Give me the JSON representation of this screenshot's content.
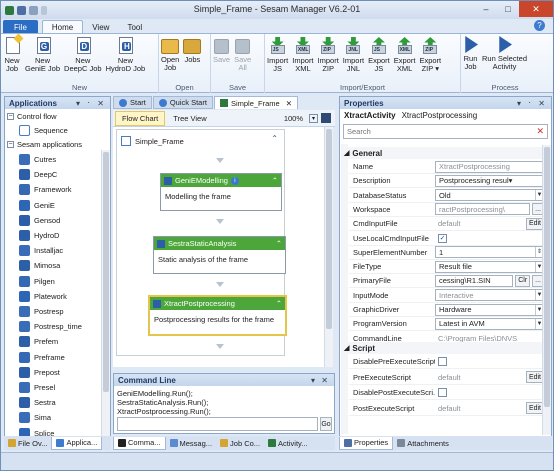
{
  "app": {
    "title": "Simple_Frame - Sesam Manager V6.2-01"
  },
  "window": {
    "min": "–",
    "max": "□",
    "close": "✕"
  },
  "tabs": {
    "file": "File",
    "home": "Home",
    "view": "View",
    "tool": "Tool"
  },
  "ribbon": {
    "groups": {
      "new": "New",
      "open": "Open",
      "save": "Save",
      "import_export": "Import/Export",
      "process": "Process"
    },
    "new": [
      {
        "label": "New\nJob",
        "icon": "new-job-icon"
      },
      {
        "label": "New\nGeniE Job",
        "letter": "G"
      },
      {
        "label": "New\nDeepC Job",
        "letter": "D"
      },
      {
        "label": "New\nHydroD Job",
        "letter": "H"
      }
    ],
    "open": [
      {
        "label": "Open\nJob",
        "icon": "folder-icon"
      },
      {
        "label": "Jobs",
        "icon": "jobs-icon"
      }
    ],
    "save": [
      {
        "label": "Save\n ",
        "icon": "save-icon"
      },
      {
        "label": "Save\nAll",
        "icon": "save-all-icon"
      }
    ],
    "io": [
      {
        "label": "Import\nJS",
        "tag": "JS"
      },
      {
        "label": "Import\nXML",
        "tag": "XML"
      },
      {
        "label": "Import\nZIP",
        "tag": "ZIP"
      },
      {
        "label": "Import\nJNL",
        "tag": "JNL"
      },
      {
        "label": "Export\nJS",
        "tag": "JS"
      },
      {
        "label": "Export\nXML",
        "tag": "XML"
      },
      {
        "label": "Export\nZIP ▾",
        "tag": "ZIP"
      }
    ],
    "process": [
      {
        "label": "Run\nJob",
        "icon": "run-icon"
      },
      {
        "label": "Run Selected\nActivity",
        "icon": "run-selected-icon"
      }
    ]
  },
  "applications": {
    "title": "Applications",
    "controls": "▾ ᛫ ✕",
    "control_flow": "Control flow",
    "sequence": "Sequence",
    "sesam_apps": "Sesam applications",
    "items": [
      "Cutres",
      "DeepC",
      "Framework",
      "GeniE",
      "Gensod",
      "HydroD",
      "Installjac",
      "Mimosa",
      "Pilgen",
      "Platework",
      "Postresp",
      "Postresp_time",
      "Prefem",
      "Preframe",
      "Prepost",
      "Presel",
      "Sestra",
      "Sima",
      "Splice"
    ]
  },
  "left_tabs": [
    "File Ov...",
    "Applica..."
  ],
  "doc_tabs": [
    "Start",
    "Quick Start",
    "Simple_Frame"
  ],
  "subtabs": {
    "flow": "Flow Chart",
    "tree": "Tree View",
    "zoom": "100%"
  },
  "flow": {
    "title": "Simple_Frame",
    "activities": [
      {
        "name": "GeniEModelling",
        "desc": "Modelling the frame",
        "info": "i"
      },
      {
        "name": "SestraStaticAnalysis",
        "desc": "Static analysis of the frame"
      },
      {
        "name": "XtractPostprocessing",
        "desc": "Postprocessing results for the frame"
      }
    ]
  },
  "command_line": {
    "title": "Command Line",
    "lines": [
      "GeniEModelling.Run();",
      "SestraStaticAnalysis.Run();",
      "XtractPostprocessing.Run();"
    ],
    "go": "Go"
  },
  "bottom_tabs": [
    "Comma...",
    "Messag...",
    "Job Co...",
    "Activity..."
  ],
  "properties": {
    "title": "Properties",
    "object": "XtractActivity",
    "object_name": "XtractPostprocessing",
    "search_placeholder": "Search",
    "general_label": "General",
    "script_label": "Script",
    "rows": [
      {
        "name": "Name",
        "value": "XtractPostprocessing",
        "style": "gray-box"
      },
      {
        "name": "Description",
        "value": "Postprocessing resul▾",
        "style": "box"
      },
      {
        "name": "DatabaseStatus",
        "value": "Old",
        "style": "dd"
      },
      {
        "name": "Workspace",
        "value": "ractPostprocessing\\",
        "style": "gray-box",
        "btn": "..."
      },
      {
        "name": "CmdInputFile",
        "value": "default",
        "style": "gray",
        "btn": "Edit"
      },
      {
        "name": "UseLocalCmdInputFile",
        "value": "✓",
        "style": "check"
      },
      {
        "name": "SuperElementNumber",
        "value": "1",
        "style": "spin"
      },
      {
        "name": "FileType",
        "value": "Result file",
        "style": "dd"
      },
      {
        "name": "PrimaryFile",
        "value": "cessing\\R1.SIN",
        "style": "box",
        "btn": "Clr",
        "btn2": "..."
      },
      {
        "name": "InputMode",
        "value": "Interactive",
        "style": "dd-gray"
      },
      {
        "name": "GraphicDriver",
        "value": "Hardware",
        "style": "dd"
      },
      {
        "name": "ProgramVersion",
        "value": "Latest in AVM",
        "style": "dd"
      },
      {
        "name": "CommandLine",
        "value": "C:\\Program Files\\DNVS",
        "style": "gray"
      }
    ],
    "script_rows": [
      {
        "name": "DisablePreExecuteScript",
        "value": "",
        "style": "check"
      },
      {
        "name": "PreExecuteScript",
        "value": "default",
        "style": "gray",
        "btn": "Edit"
      },
      {
        "name": "DisablePostExecuteScri...",
        "value": "",
        "style": "check"
      },
      {
        "name": "PostExecuteScript",
        "value": "default",
        "style": "gray",
        "btn": "Edit"
      }
    ],
    "tabs": [
      "Properties",
      "Attachments"
    ]
  }
}
